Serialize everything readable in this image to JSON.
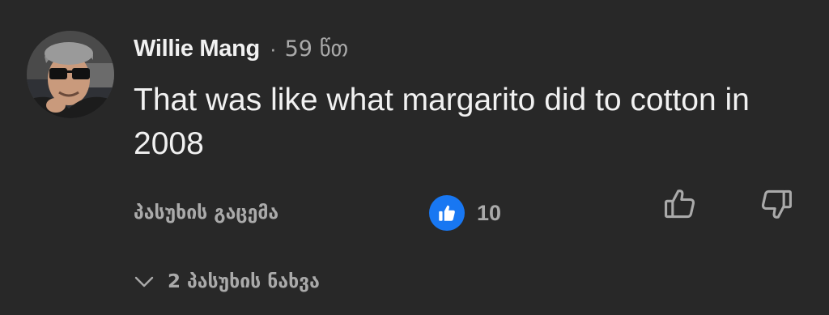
{
  "comment": {
    "author": "Willie Mang",
    "separator": "·",
    "time": "59 წთ",
    "text": "That was like what margarito did to cotton in 2008",
    "reply_label": "პასუხის გაცემა",
    "like_count": "10",
    "view_replies_label": "2 პასუხის ნახვა"
  },
  "icons": {
    "reaction": "like-reaction-icon",
    "thumb_up": "thumbs-up-icon",
    "thumb_down": "thumbs-down-icon",
    "expand": "chevron-down-icon"
  },
  "colors": {
    "background": "#282828",
    "primary_text": "#f1f1f1",
    "secondary_text": "#aaaaaa",
    "like_blue": "#1877f2"
  }
}
